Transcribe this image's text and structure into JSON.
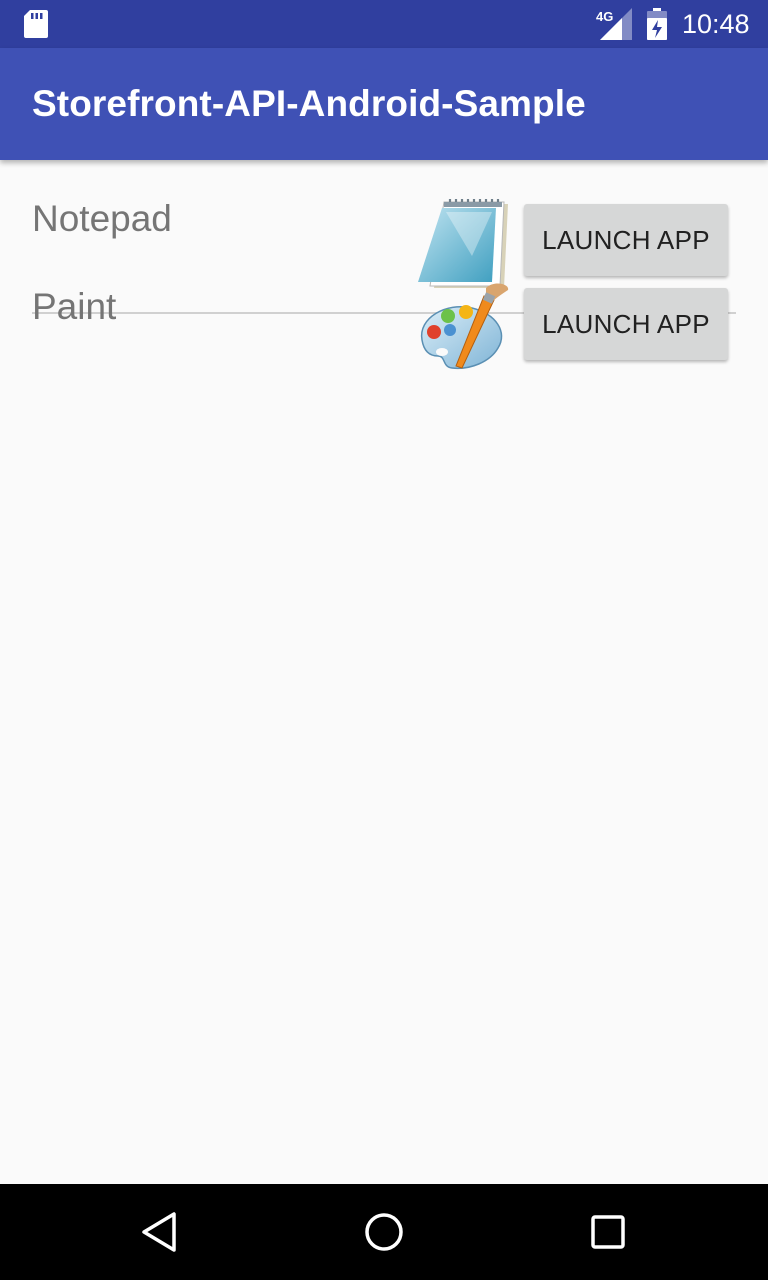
{
  "status_bar": {
    "time": "10:48",
    "network_label": "4G",
    "icons": [
      "sd-card-icon",
      "cell-signal-icon",
      "battery-charging-icon"
    ]
  },
  "app_bar": {
    "title": "Storefront-API-Android-Sample"
  },
  "apps": [
    {
      "name": "Notepad",
      "icon": "notepad-icon",
      "button_label": "LAUNCH APP"
    },
    {
      "name": "Paint",
      "icon": "paint-palette-icon",
      "button_label": "LAUNCH APP"
    }
  ],
  "nav_bar": {
    "icons": [
      "back-icon",
      "home-icon",
      "recents-icon"
    ]
  },
  "colors": {
    "status_bar": "#303f9f",
    "app_bar": "#3f51b5",
    "background": "#fafafa",
    "button": "#d6d7d7"
  }
}
